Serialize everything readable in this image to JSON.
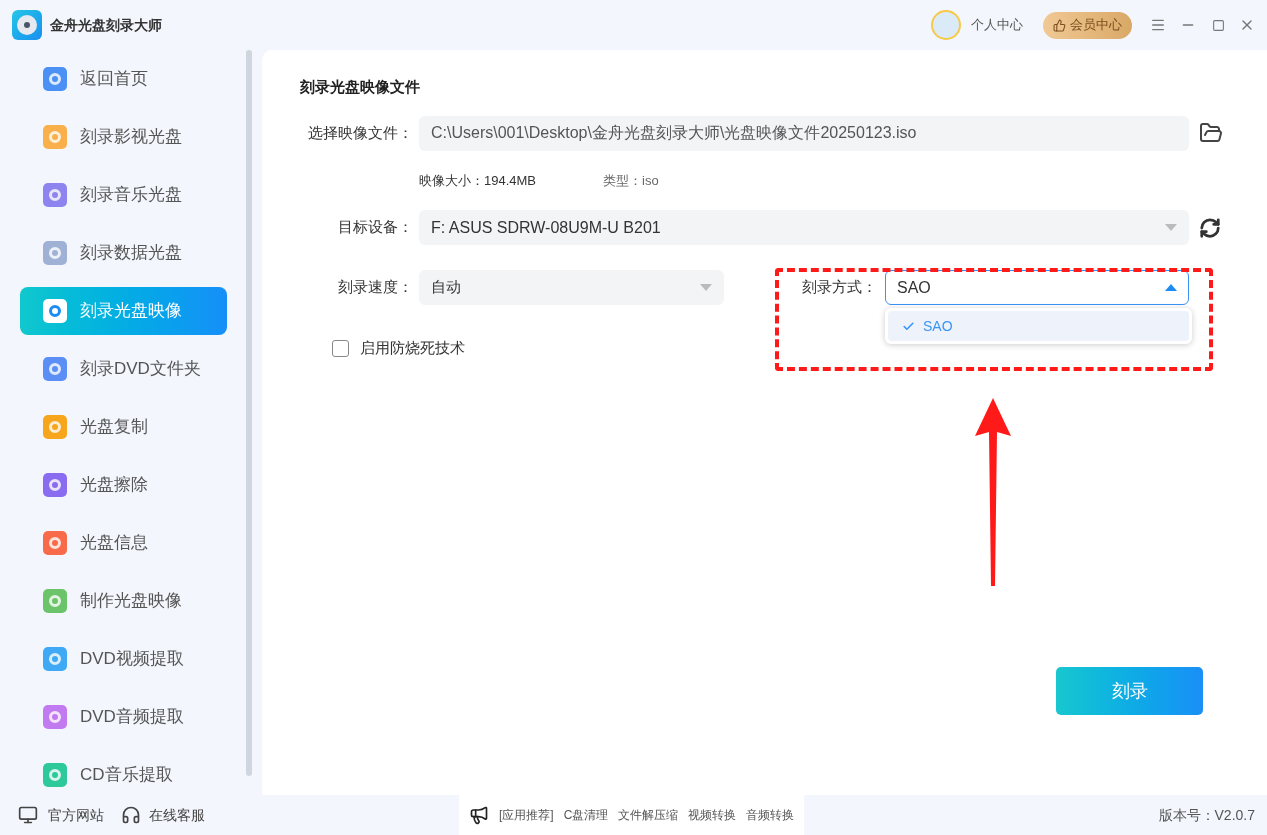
{
  "app": {
    "title": "金舟光盘刻录大师"
  },
  "header": {
    "user_center": "个人中心",
    "vip_center": "会员中心"
  },
  "sidebar": {
    "items": [
      {
        "label": "返回首页",
        "color": "#4a90f5",
        "selected": false
      },
      {
        "label": "刻录影视光盘",
        "color": "#f9b04a",
        "selected": false
      },
      {
        "label": "刻录音乐光盘",
        "color": "#8e84f0",
        "selected": false
      },
      {
        "label": "刻录数据光盘",
        "color": "#9fb2d6",
        "selected": false
      },
      {
        "label": "刻录光盘映像",
        "color": "#ffffff",
        "selected": true
      },
      {
        "label": "刻录DVD文件夹",
        "color": "#5b8ff5",
        "selected": false
      },
      {
        "label": "光盘复制",
        "color": "#f7a51c",
        "selected": false
      },
      {
        "label": "光盘擦除",
        "color": "#8a6cf0",
        "selected": false
      },
      {
        "label": "光盘信息",
        "color": "#f76b4a",
        "selected": false
      },
      {
        "label": "制作光盘映像",
        "color": "#6cc46a",
        "selected": false
      },
      {
        "label": "DVD视频提取",
        "color": "#3fa9f5",
        "selected": false
      },
      {
        "label": "DVD音频提取",
        "color": "#c27af0",
        "selected": false
      },
      {
        "label": "CD音乐提取",
        "color": "#2ec99a",
        "selected": false
      }
    ]
  },
  "panel": {
    "title": "刻录光盘映像文件",
    "image_file": {
      "label": "选择映像文件：",
      "value": "C:\\Users\\001\\Desktop\\金舟光盘刻录大师\\光盘映像文件20250123.iso"
    },
    "image_size": "映像大小：194.4MB",
    "image_type": "类型：iso",
    "device": {
      "label": "目标设备：",
      "value": "F: ASUS SDRW-08U9M-U B201"
    },
    "speed": {
      "label": "刻录速度：",
      "value": "自动"
    },
    "mode": {
      "label": "刻录方式：",
      "value": "SAO",
      "expanded": true,
      "options": [
        {
          "label": "SAO",
          "selected": true
        }
      ]
    },
    "anti_burn": {
      "label": "启用防烧死技术",
      "checked": false
    },
    "burn_button": "刻录"
  },
  "footer": {
    "website": "官方网站",
    "support": "在线客服",
    "recommend": [
      "[应用推荐]",
      "C盘清理",
      "文件解压缩",
      "视频转换",
      "音频转换"
    ],
    "version": "版本号：V2.0.7"
  }
}
